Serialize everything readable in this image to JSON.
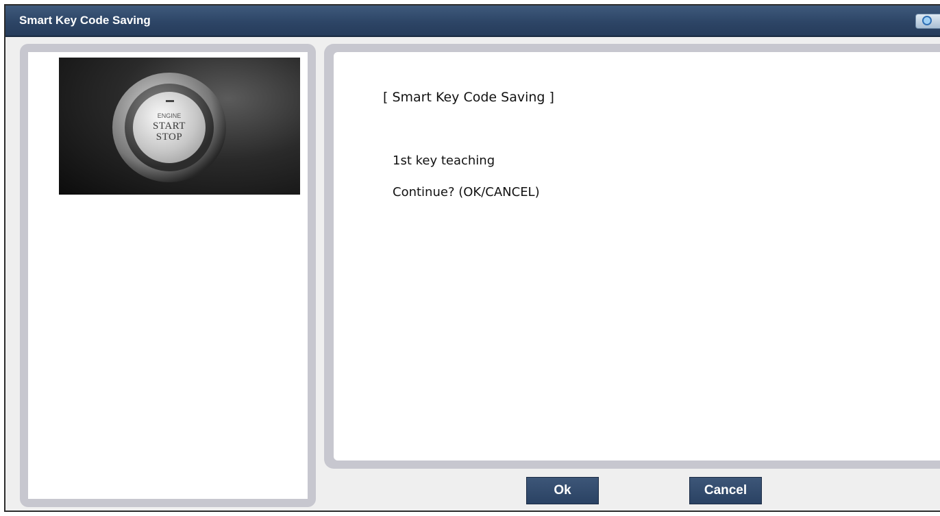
{
  "window": {
    "title": "Smart Key Code Saving",
    "icon": "camera-icon",
    "colors": {
      "titlebar": "#2d4566",
      "panel_frame": "#c7c7cf",
      "button": "#2f4869"
    }
  },
  "image_panel": {
    "photo": "engine-start-stop-button",
    "button_text": {
      "small": "ENGINE",
      "line1": "START",
      "line2": "STOP"
    }
  },
  "message": {
    "title": "[ Smart Key Code Saving ]",
    "line1": "1st key teaching",
    "line2": "Continue? (OK/CANCEL)"
  },
  "buttons": {
    "ok": "Ok",
    "cancel": "Cancel"
  }
}
